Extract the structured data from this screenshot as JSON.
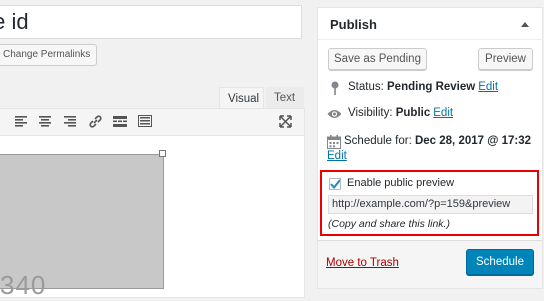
{
  "editor": {
    "title_value": "te id",
    "permalink_button": "Change Permalinks",
    "tabs": {
      "visual": "Visual",
      "text": "Text"
    },
    "image_dims": "340"
  },
  "publish": {
    "title": "Publish",
    "save_pending": "Save as Pending",
    "preview": "Preview",
    "status_label": "Status:",
    "status_value": "Pending Review",
    "visibility_label": "Visibility:",
    "visibility_value": "Public",
    "schedule_label": "Schedule for:",
    "schedule_value": "Dec 28, 2017 @ 17:32",
    "edit_link": "Edit",
    "public_preview": {
      "checkbox_label": "Enable public preview",
      "checked": true,
      "url": "http://example.com/?p=159&preview",
      "hint": "(Copy and share this link.)"
    },
    "trash": "Move to Trash",
    "schedule_button": "Schedule"
  }
}
